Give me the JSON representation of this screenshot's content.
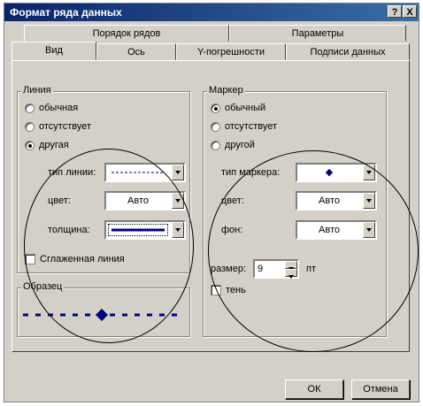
{
  "window": {
    "title": "Формат ряда данных",
    "help_label": "?",
    "close_label": "X"
  },
  "tabs_top": [
    "Порядок рядов",
    "Параметры"
  ],
  "tabs_bottom": [
    "Вид",
    "Ось",
    "Y-погрешности",
    "Подписи данных"
  ],
  "line": {
    "legend": "Линия",
    "options": [
      "обычная",
      "отсутствует",
      "другая"
    ],
    "type_label": "тип линии:",
    "color_label": "цвет:",
    "color_value": "Авто",
    "width_label": "толщина:",
    "smooth_label": "Сглаженная линия"
  },
  "sample": {
    "legend": "Образец",
    "line_color": "#000080"
  },
  "marker": {
    "legend": "Маркер",
    "options": [
      "обычный",
      "отсутствует",
      "другой"
    ],
    "type_label": "тип маркера:",
    "type_symbol": "◆",
    "color_label": "цвет:",
    "color_value": "Авто",
    "bg_label": "фон:",
    "bg_value": "Авто",
    "size_label": "размер:",
    "size_value": "9",
    "size_unit": "пт",
    "shadow_label": "тень"
  },
  "buttons": {
    "ok": "ОК",
    "cancel": "Отмена"
  }
}
